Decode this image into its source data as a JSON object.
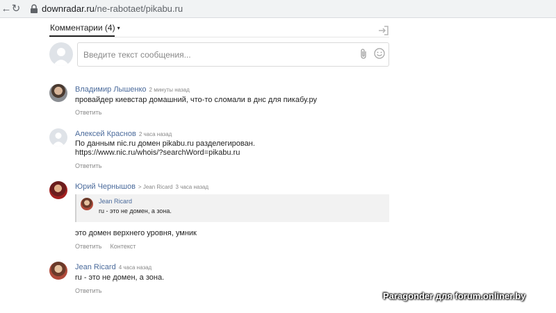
{
  "browser": {
    "url_domain": "downradar.ru",
    "url_path": "/ne-rabotaet/pikabu.ru",
    "back_icon": "arrow-left-icon",
    "reload_icon": "reload-icon",
    "lock_icon": "lock-icon"
  },
  "comments": {
    "title": "Комментарии (4)",
    "caret": "▾",
    "login_icon": "login-icon",
    "input_placeholder": "Введите текст сообщения...",
    "attach_icon": "paperclip-icon",
    "emoji_icon": "smile-icon",
    "list": [
      {
        "author": "Владимир Лышенко",
        "time": "2 минуты назад",
        "text": "провайдер киевстар домашний, что-то сломали в днс для пикабу.ру",
        "reply_label": "Ответить"
      },
      {
        "author": "Алексей Краснов",
        "time": "2 часа назад",
        "text_line1": "По данным nic.ru домен pikabu.ru разделегирован.",
        "text_line2": "https://www.nic.ru/whois/?searchWord=pikabu.ru",
        "reply_label": "Ответить"
      },
      {
        "author": "Юрий Чернышов",
        "reply_to": "> Jean Ricard",
        "time": "3 часа назад",
        "quote_author": "Jean Ricard",
        "quote_text": "ru - это не домен, а зона.",
        "text": "это домен верхнего уровня, умник",
        "reply_label": "Ответить",
        "context_label": "Контекст"
      },
      {
        "author": "Jean Ricard",
        "time": "4 часа назад",
        "text": "ru - это не домен, а зона.",
        "reply_label": "Ответить"
      }
    ]
  },
  "watermark": "Paragonder для forum.onliner.by",
  "colors": {
    "author_link": "#4a6a9b",
    "muted": "#8a8a8a",
    "quote_bg": "#f2f2f2"
  }
}
